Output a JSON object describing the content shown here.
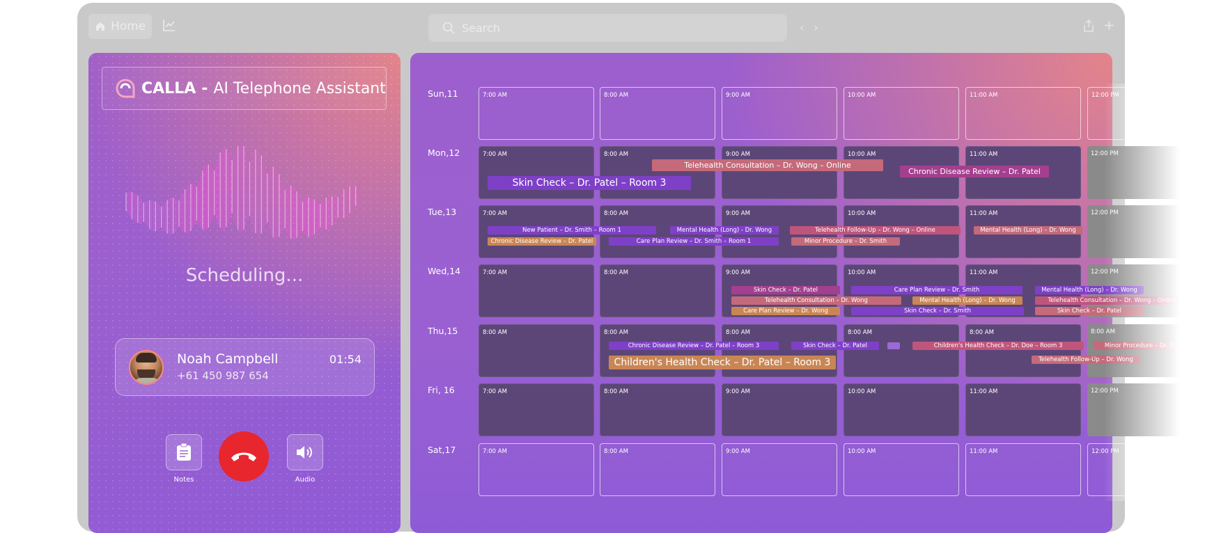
{
  "topbar": {
    "home_label": "Home",
    "search_placeholder": "Search"
  },
  "assistant": {
    "brand_name": "CALLA",
    "brand_separator": "-",
    "brand_tagline": "AI Telephone Assistant",
    "status": "Scheduling...",
    "caller": {
      "name": "Noah Campbell",
      "phone": "+61 450 987 654",
      "duration": "01:54"
    },
    "controls": {
      "notes_label": "Notes",
      "audio_label": "Audio"
    }
  },
  "calendar": {
    "days": [
      {
        "prefix": "Sun,",
        "num": "11",
        "times": [
          "7:00 AM",
          "8:00 AM",
          "9:00 AM",
          "10:00 AM",
          "11:00 AM",
          "12:00 PM"
        ]
      },
      {
        "prefix": "Mon,",
        "num": "12",
        "times": [
          "7:00 AM",
          "8:00 AM",
          "9:00 AM",
          "10:00 AM",
          "11:00 AM",
          "12:00 PM"
        ]
      },
      {
        "prefix": "Tue,",
        "num": "13",
        "times": [
          "7:00 AM",
          "8:00 AM",
          "9:00 AM",
          "10:00 AM",
          "11:00 AM",
          "12:00 PM"
        ]
      },
      {
        "prefix": "Wed,",
        "num": "14",
        "times": [
          "7:00 AM",
          "8:00 AM",
          "9:00 AM",
          "10:00 AM",
          "11:00 AM",
          "12:00 PM"
        ]
      },
      {
        "prefix": "Thu,",
        "num": "15",
        "times": [
          "8:00 AM",
          "8:00 AM",
          "8:00 AM",
          "8:00 AM",
          "8:00 AM",
          "8:00 AM"
        ]
      },
      {
        "prefix": "Fri, ",
        "num": "16",
        "times": [
          "7:00 AM",
          "8:00 AM",
          "9:00 AM",
          "10:00 AM",
          "11:00 AM",
          "12:00 PM"
        ]
      },
      {
        "prefix": "Sat,",
        "num": "17",
        "times": [
          "7:00 AM",
          "8:00 AM",
          "9:00 AM",
          "10:00 AM",
          "11:00 AM",
          "12:00 PM"
        ]
      }
    ],
    "events": {
      "mon_telehealth": "Telehealth Consultation – Dr. Wong – Online",
      "mon_chronic": "Chronic Disease Review – Dr. Patel",
      "mon_skin": "Skin Check – Dr. Patel – Room 3",
      "tue_new_patient": "New Patient – Dr. Smith – Room 1",
      "tue_mental_1": "Mental Health (Long) - Dr. Wong",
      "tue_tele_followup": "Telehealth Follow-Up – Dr. Wong – Online",
      "tue_mental_2": "Mental Health (Long) – Dr. Wong",
      "tue_chronic": "Chronic Disease Review – Dr. Patel",
      "tue_care_plan": "Care Plan Review – Dr. Smith – Room 1",
      "tue_minor": "Minor Procedure – Dr. Smith",
      "wed_skin_patel": "Skin Check – Dr. Patel",
      "wed_care_smith": "Care Plan Review – Dr. Smith",
      "wed_mental_1": "Mental Health (Long) – Dr. Wong",
      "wed_tele_wong": "Telehealth Consultation – Dr. Wong",
      "wed_mental_2": "Mental Health (Long) – Dr. Wong",
      "wed_tele_online": "Telehealth Consultation – Dr. Wong – Online",
      "wed_care_wong": "Care Plan Review – Dr. Wong",
      "wed_skin_smith": "Skin Check – Dr. Smith",
      "wed_skin_patel2": "Skin Check – Dr. Patel",
      "thu_chronic": "Chronic Disease Review – Dr. Patel – Room 3",
      "thu_skin": "Skin Check – Dr. Patel",
      "thu_children_doe": "Children's Health Check – Dr. Doe – Room 3",
      "thu_minor": "Minor Procedure – Dr. Smith",
      "thu_children_patel": "Children's Health Check – Dr. Patel – Room 3",
      "thu_tele_followup": "Telehealth Follow-Up – Dr. Wong"
    }
  },
  "colors": {
    "hangup": "#e8262d",
    "event_purple": "#7f40c8",
    "event_orange": "#c98655",
    "event_rose": "#c0557c"
  }
}
